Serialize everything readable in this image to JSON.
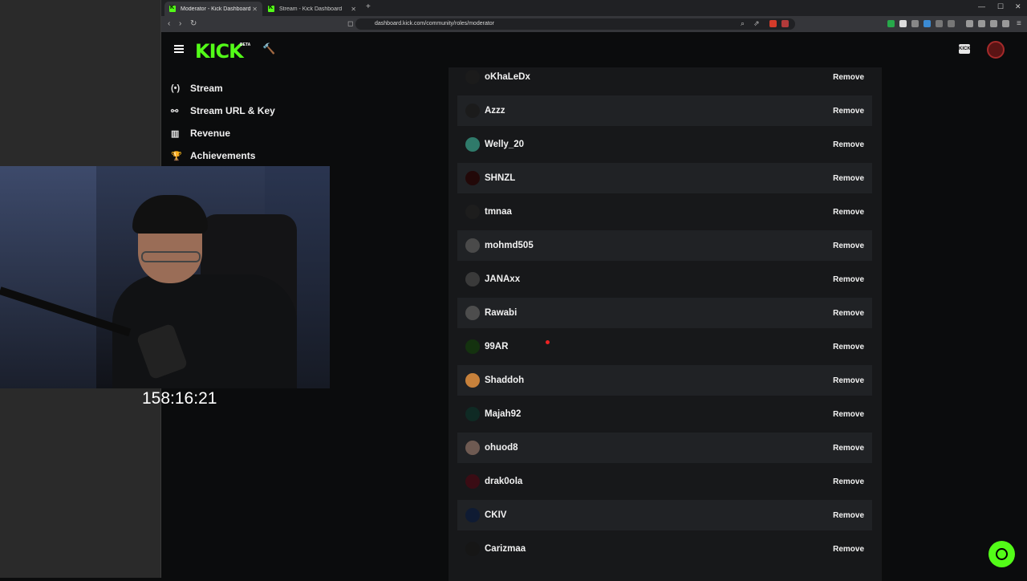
{
  "browser": {
    "tabs": [
      {
        "title": "Moderator - Kick Dashboard",
        "active": true
      },
      {
        "title": "Stream - Kick Dashboard",
        "active": false
      }
    ],
    "url": "dashboard.kick.com/community/roles/moderator"
  },
  "header": {
    "logo": "KICK",
    "beta_label": "BETA",
    "creator_badge": "KICK"
  },
  "sidebar": {
    "items": [
      {
        "label": "Stream",
        "icon": "broadcast-icon"
      },
      {
        "label": "Stream URL & Key",
        "icon": "link-icon"
      },
      {
        "label": "Revenue",
        "icon": "chart-icon"
      },
      {
        "label": "Achievements",
        "icon": "trophy-icon"
      }
    ]
  },
  "moderators": {
    "remove_label": "Remove",
    "items": [
      {
        "name": "oKhaLeDx",
        "avatar_color": "#1b1b1b"
      },
      {
        "name": "Azzz",
        "avatar_color": "#1b1b1b"
      },
      {
        "name": "Welly_20",
        "avatar_color": "#2f7a6a"
      },
      {
        "name": "SHNZL",
        "avatar_color": "#220808"
      },
      {
        "name": "tmnaa",
        "avatar_color": "#1d1d1d"
      },
      {
        "name": "mohmd505",
        "avatar_color": "#4a4a4a"
      },
      {
        "name": "JANAxx",
        "avatar_color": "#3a3a3a"
      },
      {
        "name": "Rawabi",
        "avatar_color": "#4d4d4d"
      },
      {
        "name": "99AR",
        "avatar_color": "#14320f"
      },
      {
        "name": "Shaddoh",
        "avatar_color": "#c7813b"
      },
      {
        "name": "Majah92",
        "avatar_color": "#0f2a24"
      },
      {
        "name": "ohuod8",
        "avatar_color": "#6e5a52"
      },
      {
        "name": "drak0ola",
        "avatar_color": "#3a0c14"
      },
      {
        "name": "CKIV",
        "avatar_color": "#0f1b33"
      },
      {
        "name": "Carizmaa",
        "avatar_color": "#161616"
      }
    ]
  },
  "overlay": {
    "timer": "158:16:21"
  },
  "colors": {
    "accent": "#53fc18",
    "panel": "#17181a",
    "row_alt": "#202225"
  }
}
